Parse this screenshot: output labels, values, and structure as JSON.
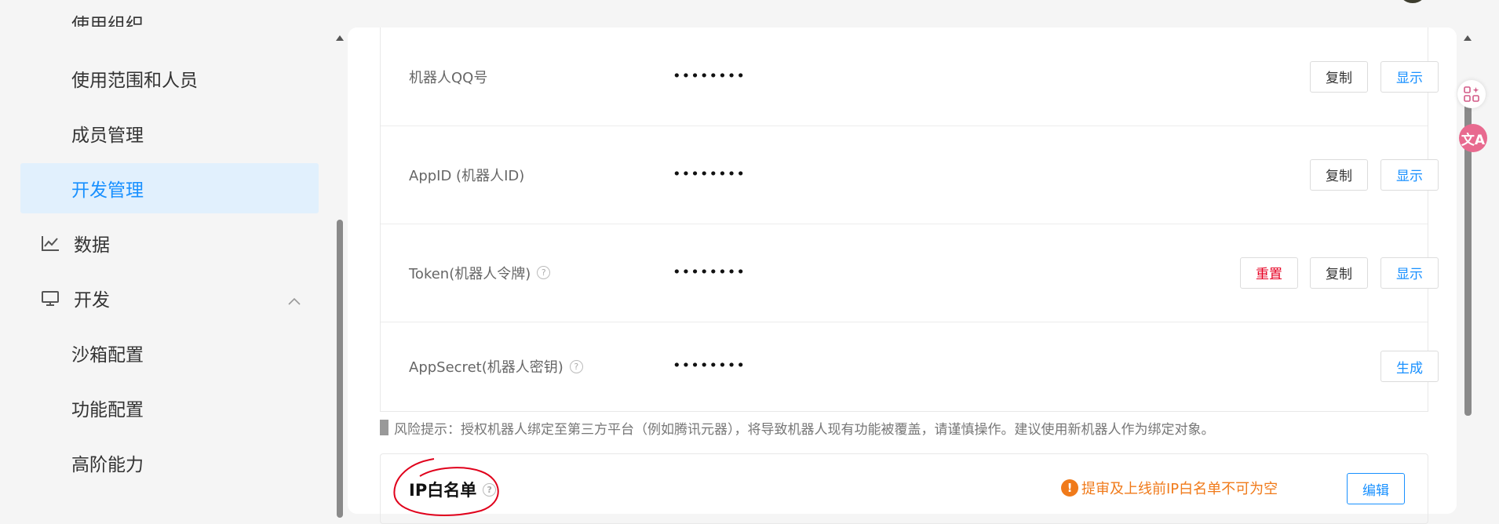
{
  "sidebar": {
    "items": [
      {
        "label": "使用范围和人员"
      },
      {
        "label": "成员管理"
      },
      {
        "label": "开发管理"
      },
      {
        "label": "数据",
        "icon": "chart-line-icon"
      },
      {
        "label": "开发",
        "icon": "monitor-icon"
      },
      {
        "label": "沙箱配置"
      },
      {
        "label": "功能配置"
      },
      {
        "label": "高阶能力"
      }
    ]
  },
  "credentials": {
    "rows": [
      {
        "label": "机器人QQ号",
        "value": "••••••••",
        "copy": "复制",
        "show": "显示"
      },
      {
        "label": "AppID (机器人ID)",
        "value": "••••••••",
        "copy": "复制",
        "show": "显示"
      },
      {
        "label": "Token(机器人令牌)",
        "value": "••••••••",
        "reset": "重置",
        "copy": "复制",
        "show": "显示"
      },
      {
        "label": "AppSecret(机器人密钥)",
        "value": "••••••••",
        "generate": "生成"
      }
    ]
  },
  "risk_notice": "风险提示：授权机器人绑定至第三方平台（例如腾讯元器），将导致机器人现有功能被覆盖，请谨慎操作。建议使用新机器人作为绑定对象。",
  "ip_whitelist": {
    "title": "IP白名单",
    "warning": "提审及上线前IP白名单不可为空",
    "edit": "编辑"
  },
  "colors": {
    "accent": "#1890ff",
    "danger": "#e60023",
    "warning": "#f07a1a",
    "active_bg": "#e1f0fd",
    "annotation": "#e0001b"
  },
  "floating": {
    "apps_icon": "apps-add-icon",
    "translate_icon": "translate-icon",
    "translate_glyph": "文A"
  }
}
